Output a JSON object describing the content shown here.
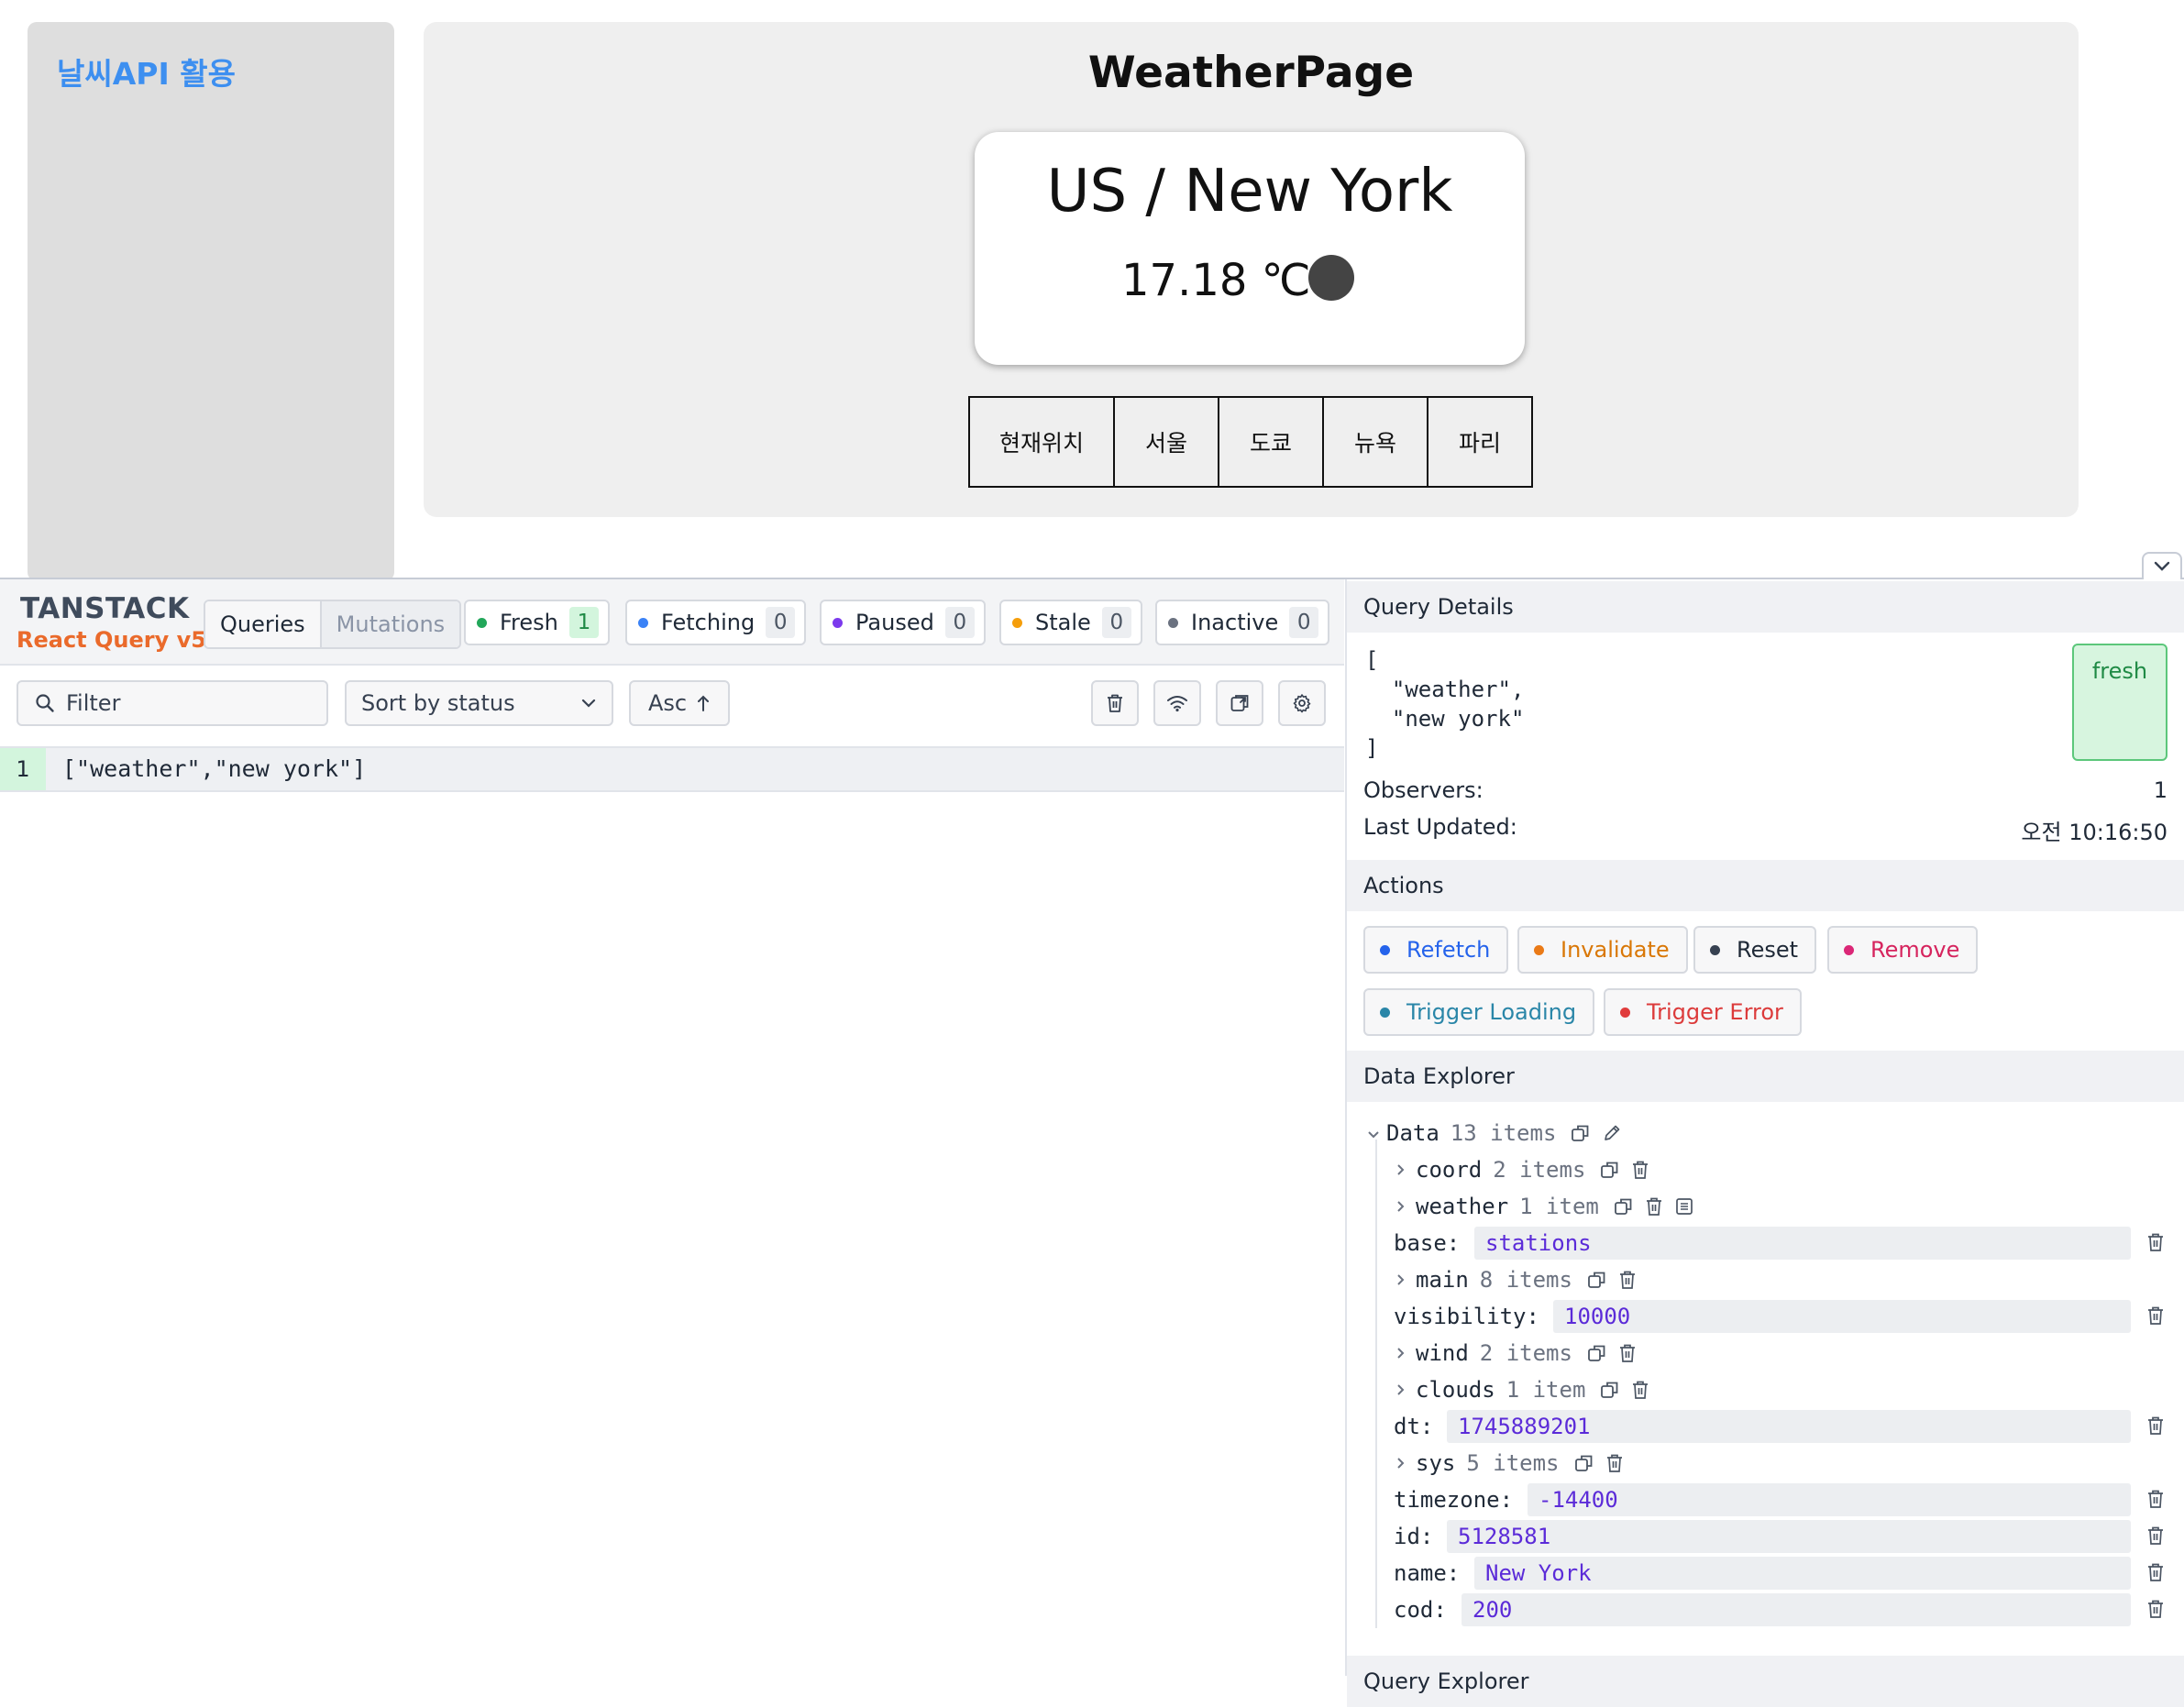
{
  "sidebar": {
    "title": "날씨API 활용"
  },
  "page": {
    "title": "WeatherPage",
    "city": "US / New York",
    "temperature": "17.18 ℃",
    "buttons": [
      "현재위치",
      "서울",
      "도쿄",
      "뉴욕",
      "파리"
    ]
  },
  "devtools": {
    "logo_top": "TANSTACK",
    "logo_bottom": "React Query v5",
    "view_tabs": {
      "queries": "Queries",
      "mutations": "Mutations"
    },
    "status_counts": [
      {
        "label": "Fresh",
        "count": "1",
        "color": "#22a75a"
      },
      {
        "label": "Fetching",
        "count": "0",
        "color": "#3b82f6"
      },
      {
        "label": "Paused",
        "count": "0",
        "color": "#7c3aed"
      },
      {
        "label": "Stale",
        "count": "0",
        "color": "#f59e0b"
      },
      {
        "label": "Inactive",
        "count": "0",
        "color": "#6b7280"
      }
    ],
    "filter_placeholder": "Filter",
    "sort_label": "Sort by status",
    "order_label": "Asc",
    "query_row": {
      "observers": "1",
      "key": "[\"weather\",\"new york\"]"
    },
    "details": {
      "header": "Query Details",
      "key_lines": "[\n  \"weather\",\n  \"new york\"\n]",
      "status": "fresh",
      "observers_label": "Observers:",
      "observers_value": "1",
      "updated_label": "Last Updated:",
      "updated_value": "오전 10:16:50"
    },
    "actions": {
      "header": "Actions",
      "refetch": "Refetch",
      "invalidate": "Invalidate",
      "reset": "Reset",
      "remove": "Remove",
      "trigger_loading": "Trigger Loading",
      "trigger_error": "Trigger Error"
    },
    "explorer": {
      "header": "Data Explorer",
      "root_label": "Data",
      "root_meta": "13 items",
      "coord": {
        "key": "coord",
        "meta": "2 items"
      },
      "weather": {
        "key": "weather",
        "meta": "1 item"
      },
      "base": {
        "key": "base:",
        "value": "stations"
      },
      "main": {
        "key": "main",
        "meta": "8 items"
      },
      "visibility": {
        "key": "visibility:",
        "value": "10000"
      },
      "wind": {
        "key": "wind",
        "meta": "2 items"
      },
      "clouds": {
        "key": "clouds",
        "meta": "1 item"
      },
      "dt": {
        "key": "dt:",
        "value": "1745889201"
      },
      "sys": {
        "key": "sys",
        "meta": "5 items"
      },
      "timezone": {
        "key": "timezone:",
        "value": "-14400"
      },
      "id": {
        "key": "id:",
        "value": "5128581"
      },
      "name": {
        "key": "name:",
        "value": "New York"
      },
      "cod": {
        "key": "cod:",
        "value": "200"
      }
    },
    "query_explorer_header": "Query Explorer"
  }
}
